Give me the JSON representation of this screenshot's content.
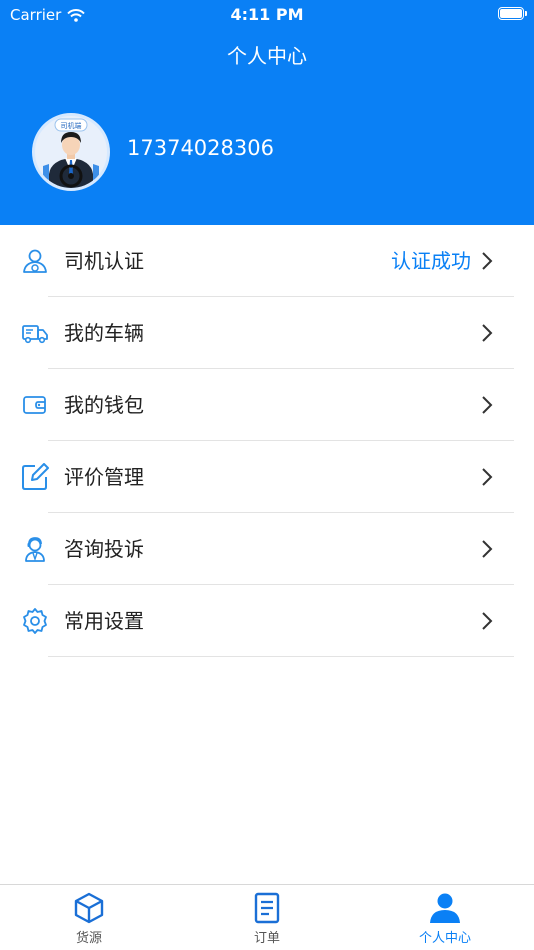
{
  "status_bar": {
    "carrier": "Carrier",
    "time": "4:11 PM"
  },
  "header": {
    "title": "个人中心",
    "avatar_badge": "司机端",
    "phone": "17374028306"
  },
  "menu": [
    {
      "label": "司机认证",
      "status": "认证成功",
      "icon": "driver-icon"
    },
    {
      "label": "我的车辆",
      "status": "",
      "icon": "truck-icon"
    },
    {
      "label": "我的钱包",
      "status": "",
      "icon": "wallet-icon"
    },
    {
      "label": "评价管理",
      "status": "",
      "icon": "edit-icon"
    },
    {
      "label": "咨询投诉",
      "status": "",
      "icon": "service-agent-icon"
    },
    {
      "label": "常用设置",
      "status": "",
      "icon": "gear-icon"
    }
  ],
  "tabs": [
    {
      "label": "货源",
      "icon": "cube-icon",
      "active": false
    },
    {
      "label": "订单",
      "icon": "document-icon",
      "active": false
    },
    {
      "label": "个人中心",
      "icon": "person-icon",
      "active": true
    }
  ],
  "colors": {
    "accent": "#0a80f5",
    "inactive_tab": "#555555"
  }
}
